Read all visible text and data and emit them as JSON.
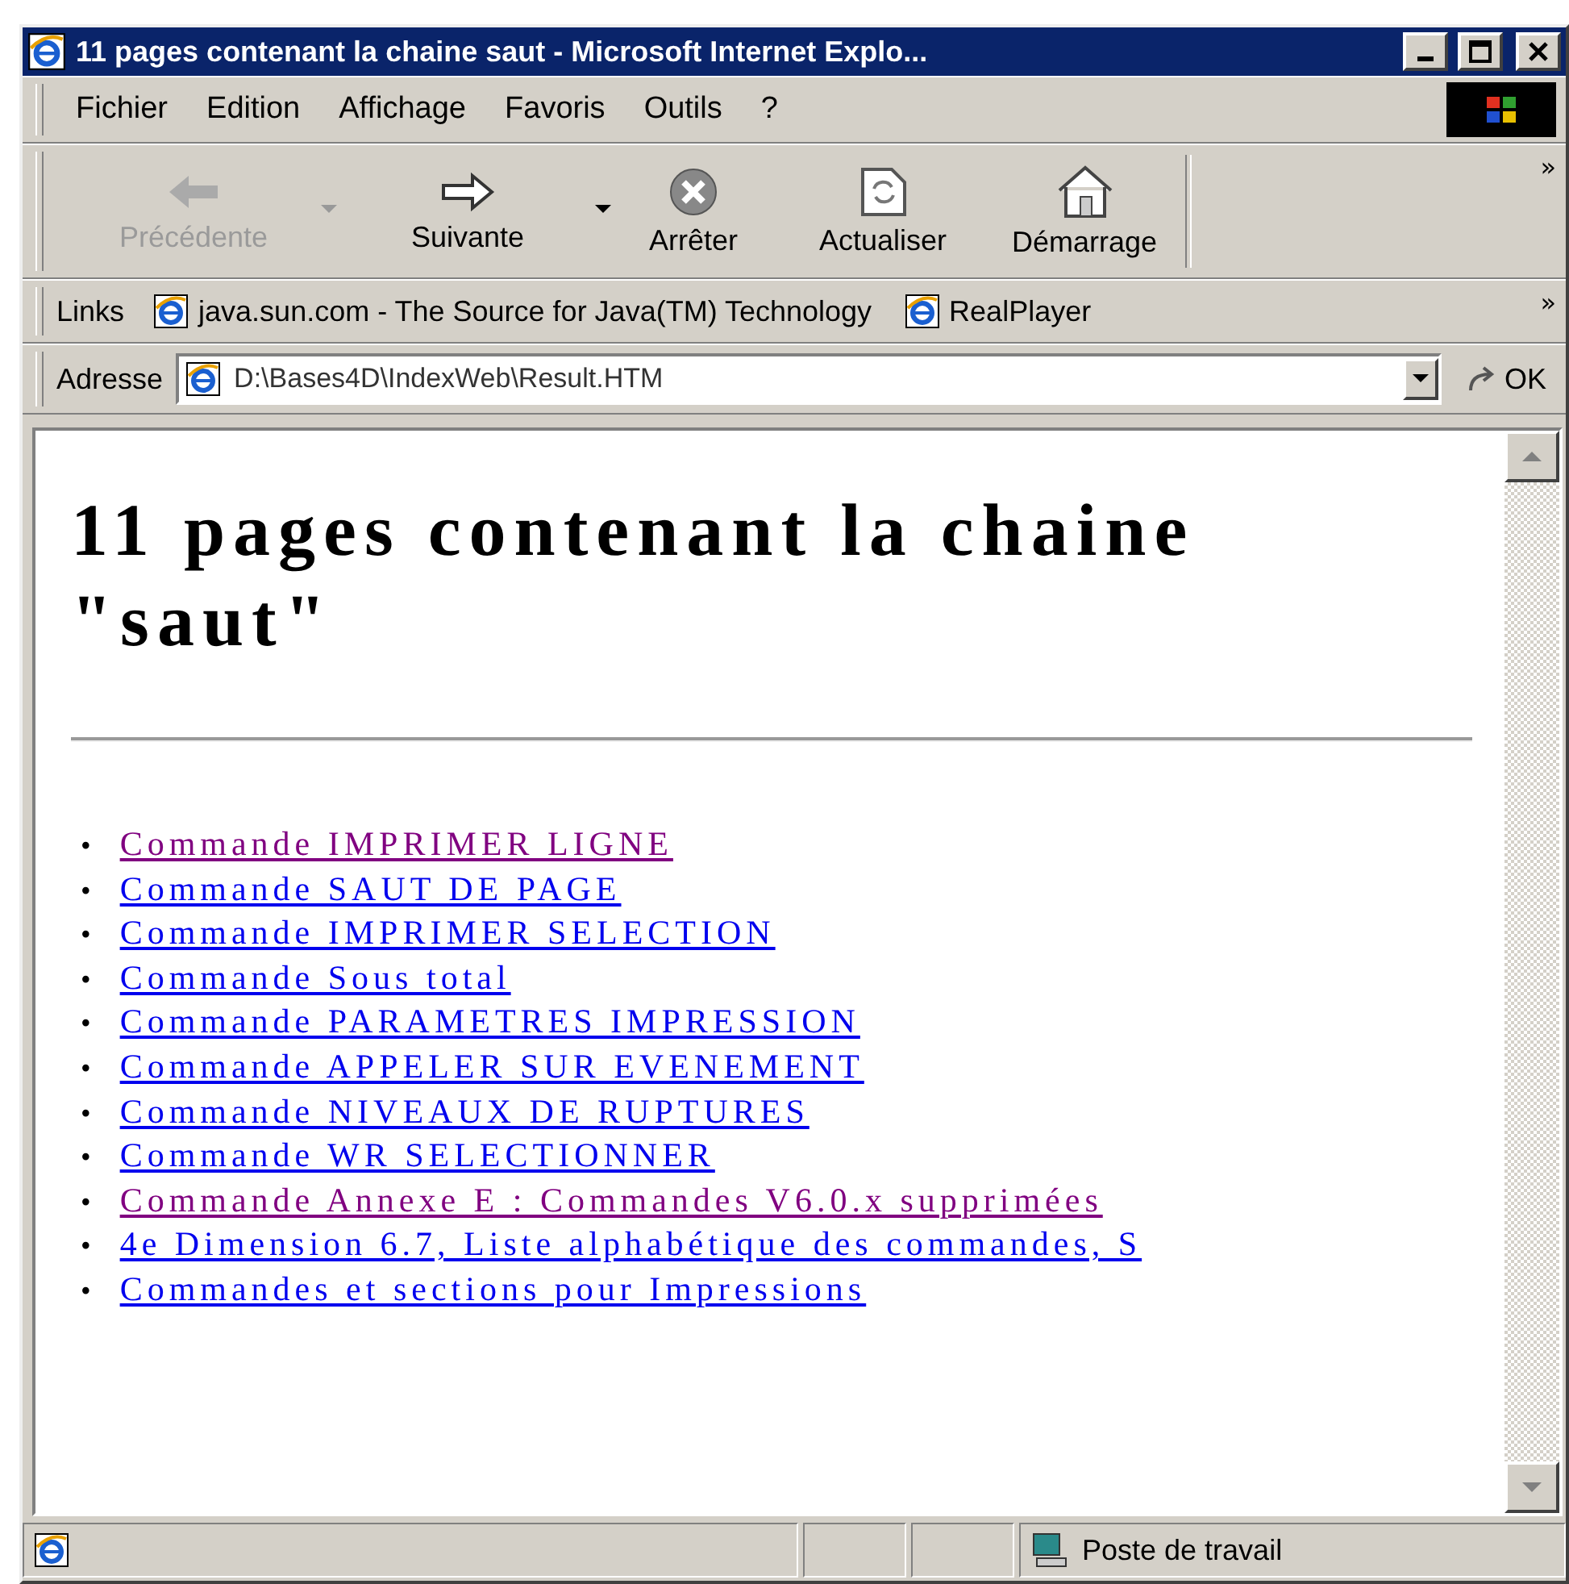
{
  "window": {
    "title": "11 pages contenant la chaine saut - Microsoft Internet Explo..."
  },
  "menu": [
    {
      "label": "Fichier"
    },
    {
      "label": "Edition"
    },
    {
      "label": "Affichage"
    },
    {
      "label": "Favoris"
    },
    {
      "label": "Outils"
    },
    {
      "label": "?"
    }
  ],
  "toolbar": {
    "buttons": [
      {
        "kind": "back",
        "label": "Précédente",
        "disabled": true,
        "dropdown": true
      },
      {
        "kind": "forward",
        "label": "Suivante",
        "disabled": false,
        "dropdown": true
      },
      {
        "kind": "stop",
        "label": "Arrêter",
        "disabled": false,
        "dropdown": false
      },
      {
        "kind": "refresh",
        "label": "Actualiser",
        "disabled": false,
        "dropdown": false
      },
      {
        "kind": "home",
        "label": "Démarrage",
        "disabled": false,
        "dropdown": false
      }
    ],
    "more": "»"
  },
  "links_bar": {
    "label": "Links",
    "items": [
      {
        "label": "java.sun.com - The Source for Java(TM) Technology"
      },
      {
        "label": "RealPlayer"
      }
    ],
    "more": "»"
  },
  "address_bar": {
    "label": "Adresse",
    "value": "D:\\Bases4D\\IndexWeb\\Result.HTM",
    "go": "OK"
  },
  "page": {
    "heading": "11 pages contenant la chaine \"saut\"",
    "links": [
      {
        "bullet": "•",
        "text": "Commande IMPRIMER LIGNE",
        "visited": true
      },
      {
        "bullet": "•",
        "text": "Commande SAUT DE PAGE",
        "visited": false
      },
      {
        "bullet": "•",
        "text": "Commande IMPRIMER SELECTION",
        "visited": false
      },
      {
        "bullet": "•",
        "text": "Commande Sous total",
        "visited": false
      },
      {
        "bullet": "•",
        "text": "Commande PARAMETRES IMPRESSION",
        "visited": false
      },
      {
        "bullet": "•",
        "text": "Commande APPELER SUR EVENEMENT",
        "visited": false
      },
      {
        "bullet": "•",
        "text": "Commande NIVEAUX DE RUPTURES",
        "visited": false
      },
      {
        "bullet": "•",
        "text": "Commande WR SELECTIONNER",
        "visited": false
      },
      {
        "bullet": "•",
        "text": "Commande Annexe E : Commandes V6.0.x supprimées",
        "visited": true
      },
      {
        "bullet": "•",
        "text": "4e Dimension 6.7, Liste alphabétique des commandes, S",
        "visited": false
      },
      {
        "bullet": "•",
        "text": "Commandes et sections pour Impressions",
        "visited": false
      }
    ]
  },
  "status_bar": {
    "zone": "Poste de travail"
  }
}
